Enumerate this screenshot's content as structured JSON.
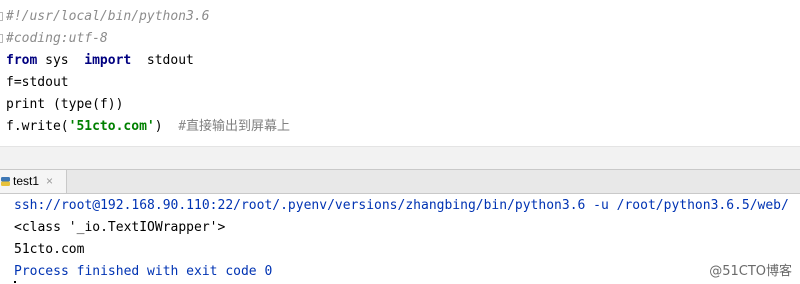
{
  "editor": {
    "line1": "#!/usr/local/bin/python3.6",
    "line2": "#coding:utf-8",
    "line3": {
      "kw_from": "from",
      "module": " sys  ",
      "kw_import": "import",
      "name": "  stdout"
    },
    "line4": "f=stdout",
    "line5": "print (type(f))",
    "line6": {
      "pre": "f.write(",
      "str": "'51cto.com'",
      "post": ")  ",
      "comment_prefix": "#",
      "comment_cn": "直接输出到屏幕上"
    }
  },
  "run_panel": {
    "tab_label": "test1",
    "tab_close": "×",
    "icon": "python-run-icon"
  },
  "console": {
    "line1": "ssh://root@192.168.90.110:22/root/.pyenv/versions/zhangbing/bin/python3.6 -u /root/python3.6.5/web/",
    "line2": "<class '_io.TextIOWrapper'>",
    "line3": "51cto.com",
    "line4": "Process finished with exit code 0"
  },
  "watermark": "@51CTO博客"
}
